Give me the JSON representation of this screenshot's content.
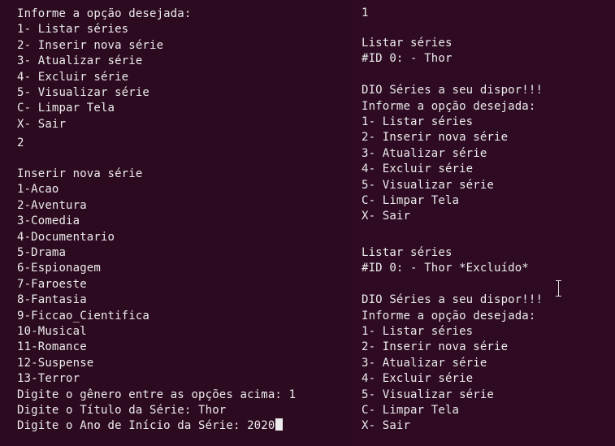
{
  "theme": {
    "background": "#2c0a1f",
    "background_right": "#2e0b22",
    "text": "#ececec"
  },
  "left": {
    "lines": [
      "Informe a opção desejada:",
      "1- Listar séries",
      "2- Inserir nova série",
      "3- Atualizar série",
      "4- Excluir série",
      "5- Visualizar série",
      "C- Limpar Tela",
      "X- Sair",
      "2",
      "",
      "Inserir nova série",
      "1-Acao",
      "2-Aventura",
      "3-Comedia",
      "4-Documentario",
      "5-Drama",
      "6-Espionagem",
      "7-Faroeste",
      "8-Fantasia",
      "9-Ficcao_Cientifica",
      "10-Musical",
      "11-Romance",
      "12-Suspense",
      "13-Terror",
      "Digite o gênero entre as opções acima: 1",
      "Digite o Título da Série: Thor",
      "Digite o Ano de Início da Série: 2020"
    ]
  },
  "right": {
    "lines": [
      "1",
      "",
      "Listar séries",
      "#ID 0: - Thor",
      "",
      "DIO Séries a seu dispor!!!",
      "Informe a opção desejada:",
      "1- Listar séries",
      "2- Inserir nova série",
      "3- Atualizar série",
      "4- Excluir série",
      "5- Visualizar série",
      "C- Limpar Tela",
      "X- Sair",
      "",
      "Listar séries",
      "#ID 0: - Thor *Excluído*",
      "",
      "DIO Séries a seu dispor!!!",
      "Informe a opção desejada:",
      "1- Listar séries",
      "2- Inserir nova série",
      "3- Atualizar série",
      "4- Excluir série",
      "5- Visualizar série",
      "C- Limpar Tela",
      "X- Sair"
    ]
  }
}
